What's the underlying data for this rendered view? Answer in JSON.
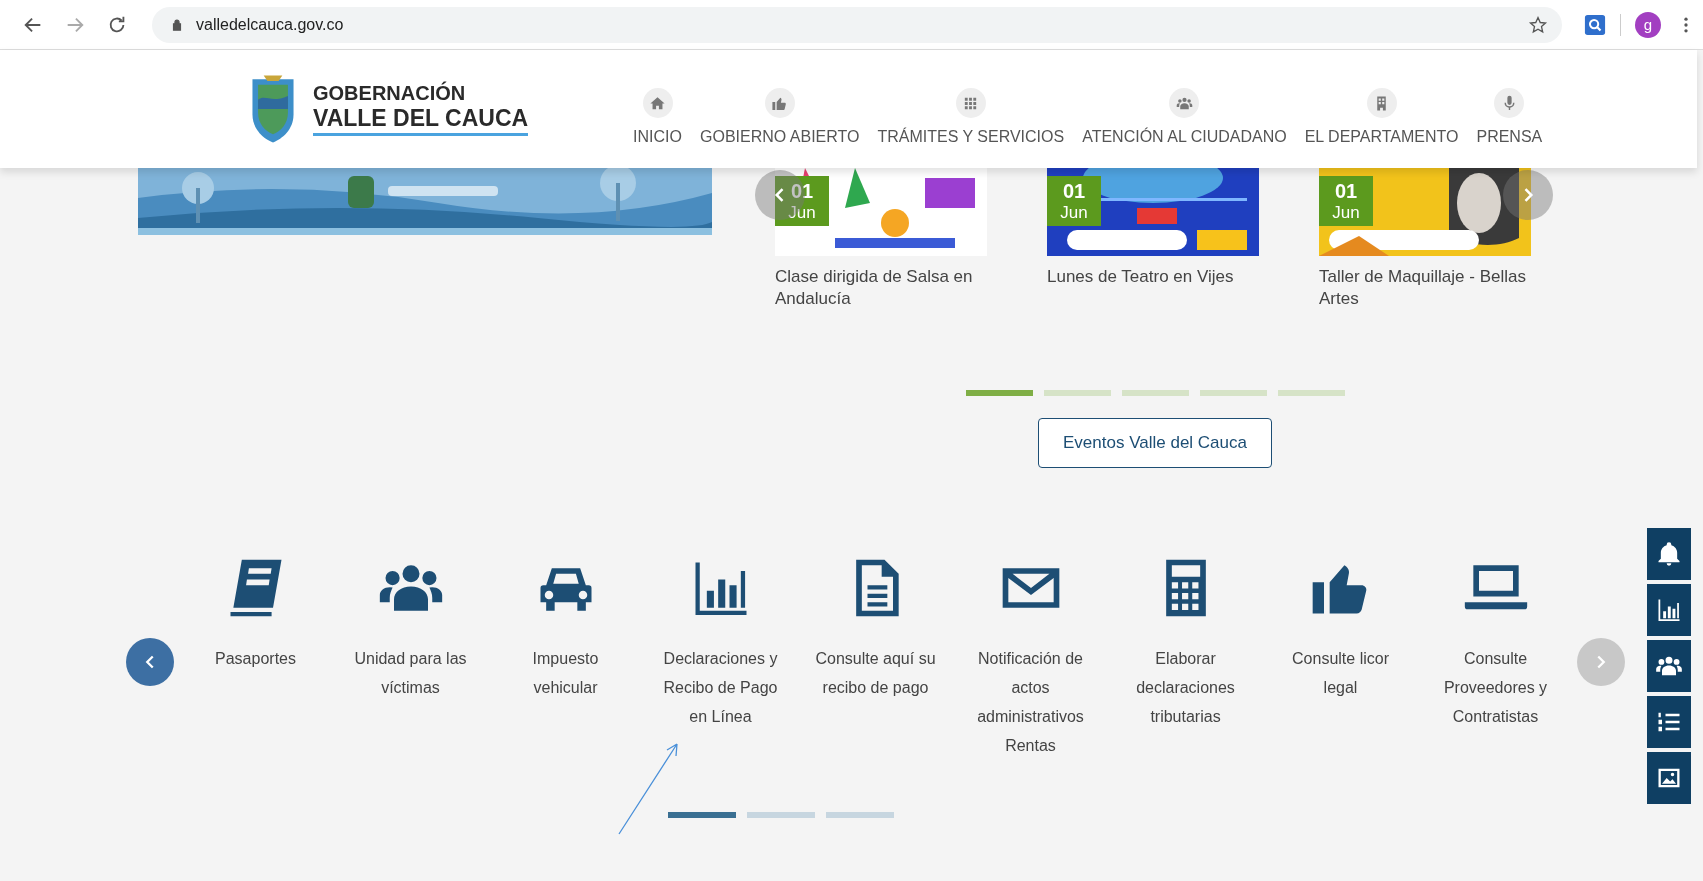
{
  "browser": {
    "url": "valledelcauca.gov.co",
    "profile_initial": "g"
  },
  "header": {
    "logo_line1": "GOBERNACIÓN",
    "logo_line2": "VALLE DEL CAUCA",
    "nav": [
      {
        "label": "INICIO"
      },
      {
        "label": "GOBIERNO ABIERTO"
      },
      {
        "label": "TRÁMITES Y SERVICIOS"
      },
      {
        "label": "ATENCIÓN AL CIUDADANO"
      },
      {
        "label": "EL DEPARTAMENTO"
      },
      {
        "label": "PRENSA"
      }
    ]
  },
  "events": {
    "items": [
      {
        "day": "01",
        "month": "Jun",
        "title": "Clase dirigida de Salsa en Andalucía"
      },
      {
        "day": "01",
        "month": "Jun",
        "title": "Lunes de Teatro en Vijes"
      },
      {
        "day": "01",
        "month": "Jun",
        "title": "Taller de Maquillaje - Bellas Artes"
      }
    ],
    "indicators": [
      {
        "selected": true
      },
      {
        "selected": false
      },
      {
        "selected": false
      },
      {
        "selected": false
      },
      {
        "selected": false
      }
    ],
    "button": "Eventos Valle del Cauca"
  },
  "services": {
    "items": [
      {
        "label": "Pasaportes"
      },
      {
        "label": "Unidad para las víctimas"
      },
      {
        "label": "Impuesto vehicular"
      },
      {
        "label": "Declaraciones y Recibo de Pago en Línea"
      },
      {
        "label": "Consulte aquí su recibo de pago"
      },
      {
        "label": "Notificación de actos administrativos Rentas"
      },
      {
        "label": "Elaborar declaraciones tributarias"
      },
      {
        "label": "Consulte licor legal"
      },
      {
        "label": "Consulte Proveedores y Contratistas"
      }
    ],
    "indicators": [
      {
        "selected": true
      },
      {
        "selected": false
      },
      {
        "selected": false
      }
    ]
  }
}
